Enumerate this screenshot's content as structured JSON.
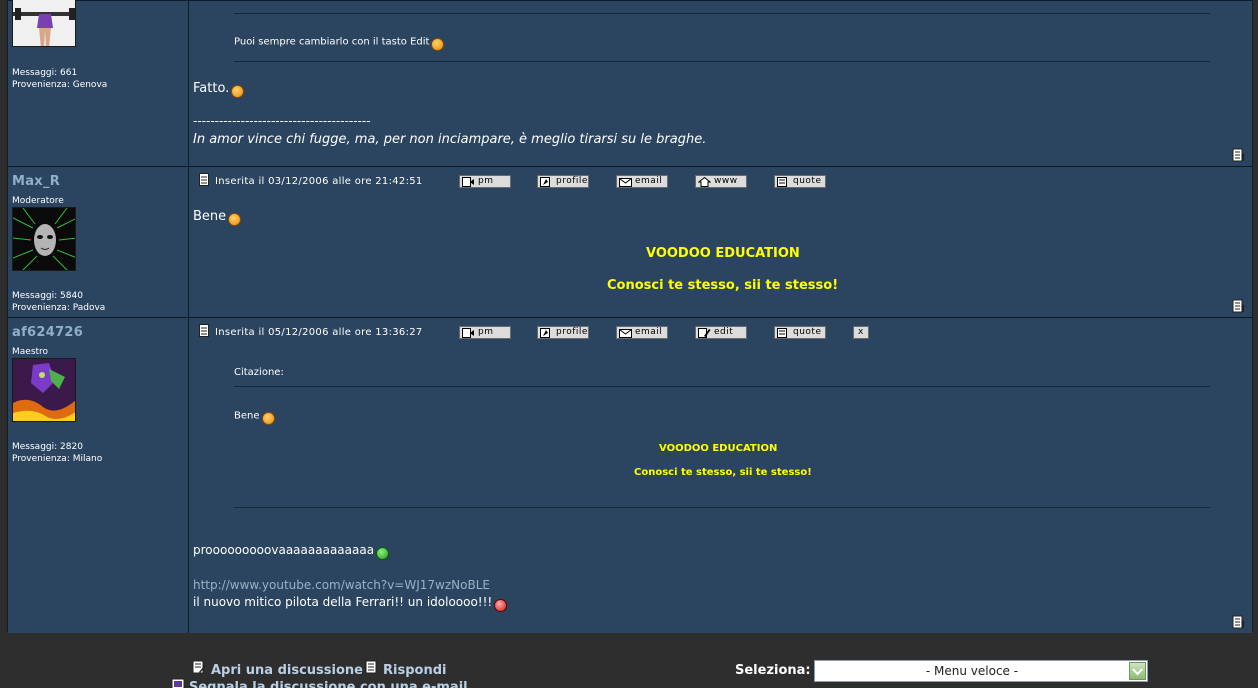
{
  "posts": [
    {
      "stats": {
        "messages": "Messaggi: 661",
        "location": "Provenienza: Genova"
      },
      "quote_tail": "Puoi sempre cambiarlo con il tasto Edit",
      "message": "Fatto.",
      "separator": "-----------------------------------------",
      "signature": "In amor vince chi fugge, ma, per non inciampare, è meglio tirarsi su le braghe."
    },
    {
      "username": "Max_R",
      "rank": "Moderatore",
      "stats": {
        "messages": "Messaggi: 5840",
        "location": "Provenienza: Padova"
      },
      "date": "Inserita il 03/12/2006 alle ore 21:42:51",
      "buttons": [
        "pm",
        "profile",
        "email",
        "www",
        "quote"
      ],
      "message": "Bene",
      "signature_line1": "VOODOO EDUCATION",
      "signature_line2": "Conosci te stesso, sii te stesso!"
    },
    {
      "username": "af624726",
      "rank": "Maestro",
      "stats": {
        "messages": "Messaggi: 2820",
        "location": "Provenienza: Milano"
      },
      "date": "Inserita il 05/12/2006 alle ore 13:36:27",
      "buttons": [
        "pm",
        "profile",
        "email",
        "edit",
        "quote",
        "x"
      ],
      "quote_label": "Citazione:",
      "quote_message": "Bene",
      "quote_sig1": "VOODOO EDUCATION",
      "quote_sig2": "Conosci te stesso, sii te stesso!",
      "message": "prooooooooovaaaaaaaaaaaaa",
      "link": "http://www.youtube.com/watch?v=WJ17wzNoBLE",
      "message2": "il nuovo mitico pilota della Ferrari!! un idoloooo!!!"
    }
  ],
  "footer": {
    "open_discussion": "Apri una discussione",
    "reply": "Rispondi",
    "report": "Segnala la discussione con una e-mail",
    "select_label": "Seleziona:",
    "quick_menu": "- Menu veloce -"
  }
}
